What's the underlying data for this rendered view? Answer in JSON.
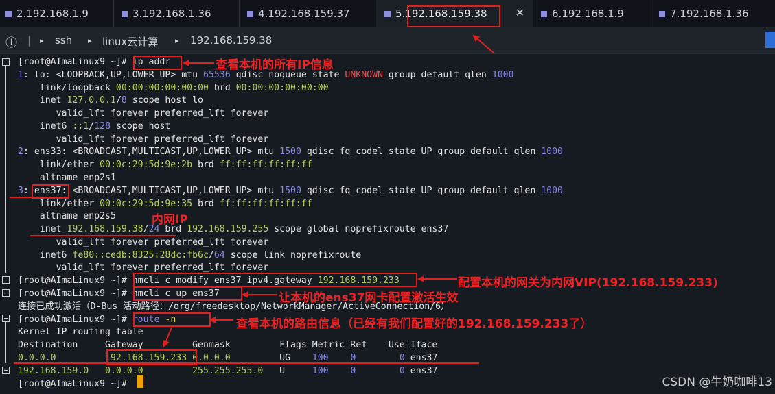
{
  "tabs": [
    {
      "label": "2.192.168.1.9"
    },
    {
      "label": "3.192.168.1.36"
    },
    {
      "label": "4.192.168.159.37"
    },
    {
      "label": "5.192.168.159.38",
      "active": true
    },
    {
      "label": "6.192.168.1.9"
    },
    {
      "label": "7.192.168.1.36"
    }
  ],
  "pathbar": {
    "info": "ⓘ",
    "sep": "▸",
    "item1": "ssh",
    "item2": "linux云计算",
    "item3": "192.168.159.38"
  },
  "lines": [
    {
      "segs": [
        {
          "t": "[root@AImaLinux9 ~]# "
        },
        {
          "t": "ip addr"
        }
      ]
    },
    {
      "segs": [
        {
          "t": "1",
          "c": "b"
        },
        {
          "t": ": lo: <LOOPBACK,UP,LOWER_UP> mtu "
        },
        {
          "t": "65536",
          "c": "b"
        },
        {
          "t": " qdisc noqueue state "
        },
        {
          "t": "UNKNOWN",
          "c": "r"
        },
        {
          "t": " group default qlen "
        },
        {
          "t": "1000",
          "c": "b"
        }
      ]
    },
    {
      "segs": [
        {
          "t": "    link/loopback "
        },
        {
          "t": "00:00:00:00:00:00",
          "c": "g"
        },
        {
          "t": " brd "
        },
        {
          "t": "00:00:00:00:00:00",
          "c": "g"
        }
      ]
    },
    {
      "segs": [
        {
          "t": "    inet "
        },
        {
          "t": "127.0.0.1",
          "c": "g"
        },
        {
          "t": "/"
        },
        {
          "t": "8",
          "c": "b"
        },
        {
          "t": " scope host lo"
        }
      ]
    },
    {
      "segs": [
        {
          "t": "       valid_lft forever preferred_lft forever"
        }
      ]
    },
    {
      "segs": [
        {
          "t": "    inet6 "
        },
        {
          "t": "::1",
          "c": "g"
        },
        {
          "t": "/"
        },
        {
          "t": "128",
          "c": "b"
        },
        {
          "t": " scope host"
        }
      ]
    },
    {
      "segs": [
        {
          "t": "       valid_lft forever preferred_lft forever"
        }
      ]
    },
    {
      "segs": [
        {
          "t": "2",
          "c": "b"
        },
        {
          "t": ": ens33: <BROADCAST,MULTICAST,UP,LOWER_UP> mtu "
        },
        {
          "t": "1500",
          "c": "b"
        },
        {
          "t": " qdisc fq_codel state UP group default qlen "
        },
        {
          "t": "1000",
          "c": "b"
        }
      ]
    },
    {
      "segs": [
        {
          "t": "    link/ether "
        },
        {
          "t": "00:0c:29:5d:9e:2b",
          "c": "g"
        },
        {
          "t": " brd "
        },
        {
          "t": "ff:ff:ff:ff:ff:ff",
          "c": "g"
        }
      ]
    },
    {
      "segs": [
        {
          "t": "    altname enp2s1"
        }
      ]
    },
    {
      "segs": [
        {
          "t": "3",
          "c": "b"
        },
        {
          "t": ": ens37: <BROADCAST,MULTICAST,UP,LOWER_UP> mtu "
        },
        {
          "t": "1500",
          "c": "b"
        },
        {
          "t": " qdisc fq_codel state UP group default qlen "
        },
        {
          "t": "1000",
          "c": "b"
        }
      ]
    },
    {
      "segs": [
        {
          "t": "    link/ether "
        },
        {
          "t": "00:0c:29:5d:9e:35",
          "c": "g"
        },
        {
          "t": " brd "
        },
        {
          "t": "ff:ff:ff:ff:ff:ff",
          "c": "g"
        }
      ]
    },
    {
      "segs": [
        {
          "t": "    altname enp2s5"
        }
      ]
    },
    {
      "segs": [
        {
          "t": "    inet "
        },
        {
          "t": "192.168.159.38",
          "c": "g"
        },
        {
          "t": "/"
        },
        {
          "t": "24",
          "c": "b"
        },
        {
          "t": " brd "
        },
        {
          "t": "192.168.159.255",
          "c": "g"
        },
        {
          "t": " scope global noprefixroute ens37"
        }
      ]
    },
    {
      "segs": [
        {
          "t": "       valid_lft forever preferred_lft forever"
        }
      ]
    },
    {
      "segs": [
        {
          "t": "    inet6 "
        },
        {
          "t": "fe80::cedb:8325:28dc:fb6c",
          "c": "g"
        },
        {
          "t": "/"
        },
        {
          "t": "64",
          "c": "b"
        },
        {
          "t": " scope link noprefixroute"
        }
      ]
    },
    {
      "segs": [
        {
          "t": "       valid_lft forever preferred_lft forever"
        }
      ]
    },
    {
      "segs": [
        {
          "t": "[root@AImaLinux9 ~]# "
        },
        {
          "t": "nmcli c modify ens37 ipv4.gateway "
        },
        {
          "t": "192.168.159.233",
          "c": "g"
        }
      ]
    },
    {
      "segs": [
        {
          "t": "[root@AImaLinux9 ~]# "
        },
        {
          "t": "nmcli c up ens37"
        }
      ]
    },
    {
      "segs": [
        {
          "t": "连接已成功激活（D-Bus 活动路径：/org/freedesktop/NetworkManager/ActiveConnection/6）"
        }
      ]
    },
    {
      "segs": [
        {
          "t": "[root@AImaLinux9 ~]# "
        },
        {
          "t": "route ",
          "c": "b"
        },
        {
          "t": "-n",
          "c": "y"
        }
      ]
    },
    {
      "segs": [
        {
          "t": "Kernel IP routing table"
        }
      ]
    },
    {
      "segs": [
        {
          "t": "Destination     Gateway         Genmask         Flags Metric Ref    Use Iface"
        }
      ]
    },
    {
      "segs": [
        {
          "t": "0.0.0.0",
          "c": "g"
        },
        {
          "t": "         "
        },
        {
          "t": "192.168.159.233",
          "c": "g"
        },
        {
          "t": " "
        },
        {
          "t": "0.0.0.0",
          "c": "g"
        },
        {
          "t": "         UG    "
        },
        {
          "t": "100",
          "c": "b"
        },
        {
          "t": "    "
        },
        {
          "t": "0",
          "c": "b"
        },
        {
          "t": "        "
        },
        {
          "t": "0",
          "c": "b"
        },
        {
          "t": " ens37"
        }
      ]
    },
    {
      "segs": [
        {
          "t": "192.168.159.0",
          "c": "g"
        },
        {
          "t": "   "
        },
        {
          "t": "0.0.0.0",
          "c": "g"
        },
        {
          "t": "         "
        },
        {
          "t": "255.255.255.0",
          "c": "g"
        },
        {
          "t": "   U     "
        },
        {
          "t": "100",
          "c": "b"
        },
        {
          "t": "    "
        },
        {
          "t": "0",
          "c": "b"
        },
        {
          "t": "        "
        },
        {
          "t": "0",
          "c": "b"
        },
        {
          "t": " ens37"
        }
      ]
    },
    {
      "segs": [
        {
          "t": "[root@AImaLinux9 ~]# "
        }
      ]
    }
  ],
  "annotations": {
    "ip_addr": "查看本机的所有IP信息",
    "inner_ip": "内网IP",
    "gateway": "配置本机的网关为内网VIP(192.168.159.233)",
    "activate": "让本机的ens37网卡配置激活生效",
    "route": "查看本机的路由信息（已经有我们配置好的192.168.159.233了）"
  },
  "watermark": "CSDN @牛奶咖啡13",
  "colors": {
    "green": "#b7d15d",
    "blue": "#8a8ae6",
    "red": "#e05252",
    "yellow": "#e5d55a",
    "annotation": "#ee2222",
    "cursor": "#f0a000"
  }
}
